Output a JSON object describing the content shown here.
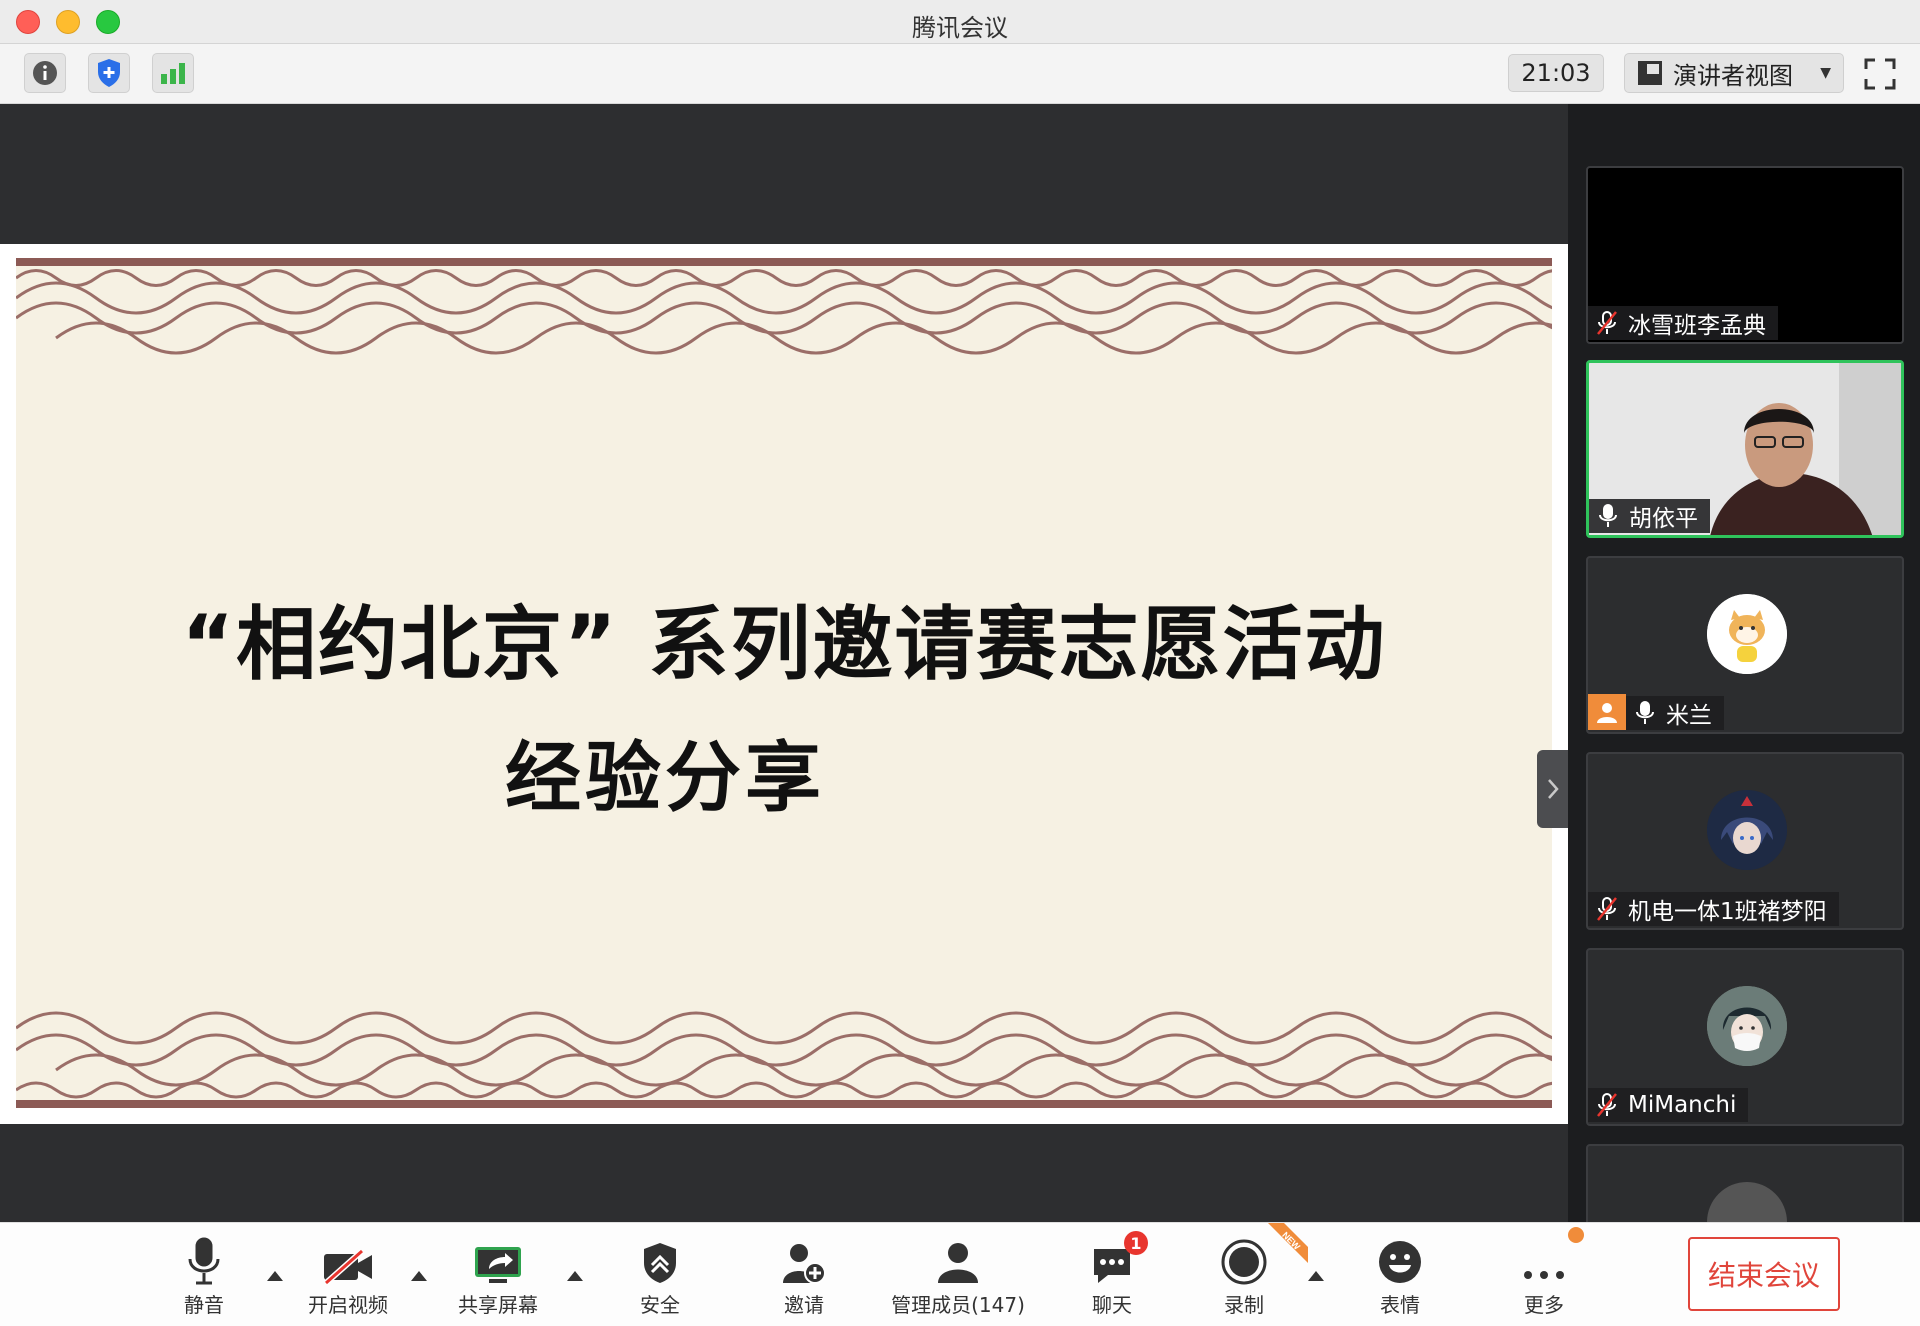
{
  "window": {
    "title": "腾讯会议"
  },
  "toolbar": {
    "time": "21:03",
    "view_mode": "演讲者视图"
  },
  "slide": {
    "title": "“相约北京”  系列邀请赛志愿活动",
    "subtitle": "经验分享"
  },
  "participants": [
    {
      "name": "冰雪班李孟典",
      "mic": "muted",
      "video": "black"
    },
    {
      "name": "胡依平",
      "mic": "on",
      "video": "camera",
      "active_speaker": true
    },
    {
      "name": "米兰",
      "mic": "on",
      "video": "avatar",
      "host_tag": true
    },
    {
      "name": "机电一体1班褚梦阳",
      "mic": "muted",
      "video": "avatar"
    },
    {
      "name": "MiManchi",
      "mic": "muted",
      "video": "avatar"
    }
  ],
  "controls": {
    "mute": "静音",
    "video": "开启视频",
    "share": "共享屏幕",
    "security": "安全",
    "invite": "邀请",
    "members": "管理成员(147)",
    "chat": "聊天",
    "chat_badge": "1",
    "record": "录制",
    "record_badge": "NEW",
    "reactions": "表情",
    "more": "更多",
    "end": "结束会议"
  },
  "colors": {
    "accent_green": "#2fc35b",
    "end_red": "#e0453b",
    "badge_red": "#e8352e",
    "orange": "#f08c3a"
  }
}
